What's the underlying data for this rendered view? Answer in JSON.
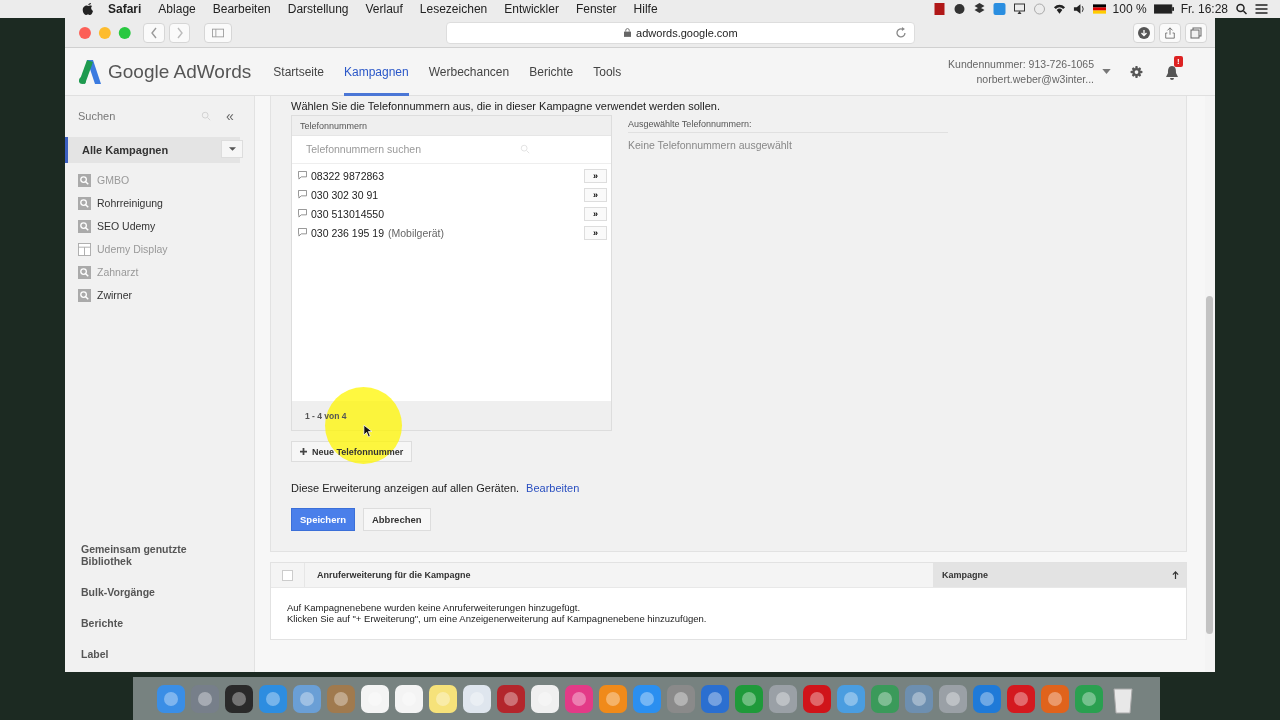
{
  "menu_bar": {
    "app": "Safari",
    "menus": [
      "Ablage",
      "Bearbeiten",
      "Darstellung",
      "Verlauf",
      "Lesezeichen",
      "Entwickler",
      "Fenster",
      "Hilfe"
    ],
    "battery": "100 %",
    "clock": "Fr. 16:28"
  },
  "browser": {
    "url": "adwords.google.com"
  },
  "header": {
    "logo": "Google AdWords",
    "nav": [
      {
        "label": "Startseite",
        "selected": false
      },
      {
        "label": "Kampagnen",
        "selected": true
      },
      {
        "label": "Werbechancen",
        "selected": false
      },
      {
        "label": "Berichte",
        "selected": false
      },
      {
        "label": "Tools",
        "selected": false
      }
    ],
    "customer_number": "Kundennummer: 913-726-1065",
    "account": "norbert.weber@w3inter...",
    "notification_badge": "!"
  },
  "sidebar": {
    "search_placeholder": "Suchen",
    "collapse": "«",
    "all_campaigns": "Alle Kampagnen",
    "campaigns": [
      {
        "name": "GMBO",
        "kind": "search",
        "disabled": true
      },
      {
        "name": "Rohrreinigung",
        "kind": "search",
        "disabled": false
      },
      {
        "name": "SEO Udemy",
        "kind": "search",
        "disabled": false
      },
      {
        "name": "Udemy Display",
        "kind": "display",
        "disabled": true
      },
      {
        "name": "Zahnarzt",
        "kind": "search",
        "disabled": true
      },
      {
        "name": "Zwirner",
        "kind": "search",
        "disabled": false
      }
    ],
    "links": [
      "Gemeinsam genutzte Bibliothek",
      "Bulk-Vorgänge",
      "Berichte",
      "Label"
    ]
  },
  "phone_picker": {
    "instruction": "Wählen Sie die Telefonnummern aus, die in dieser Kampagne verwendet werden sollen.",
    "list_heading": "Telefonnummern",
    "search_placeholder": "Telefonnummern suchen",
    "numbers": [
      {
        "number": "08322 9872863",
        "add": "»"
      },
      {
        "number": "030 302 30 91",
        "add": "»"
      },
      {
        "number": "030 513014550",
        "add": "»"
      },
      {
        "number": "030 236 195 19",
        "note": "(Mobilgerät)",
        "add": "»"
      }
    ],
    "pagination": "1 - 4 von 4",
    "new_button": "Neue Telefonnummer",
    "selected_heading": "Ausgewählte Telefonnummern:",
    "selected_empty": "Keine Telefonnummern ausgewählt"
  },
  "device_note": {
    "text": "Diese Erweiterung anzeigen auf allen Geräten.",
    "link": "Bearbeiten"
  },
  "buttons": [
    {
      "label": "Speichern",
      "kind": "primary"
    },
    {
      "label": "Abbrechen",
      "kind": "secondary"
    }
  ],
  "table": {
    "select_all": {
      "checked": false
    },
    "columns": [
      "Anruferweiterung für die Kampagne",
      "Kampagne"
    ],
    "empty_message": [
      "Auf Kampagnenebene wurden keine Anruferweiterungen hinzugefügt.",
      "Klicken Sie auf \"+ Erweiterung\", um eine Anzeigenerweiterung auf Kampagnenebene hinzuzufügen."
    ]
  }
}
